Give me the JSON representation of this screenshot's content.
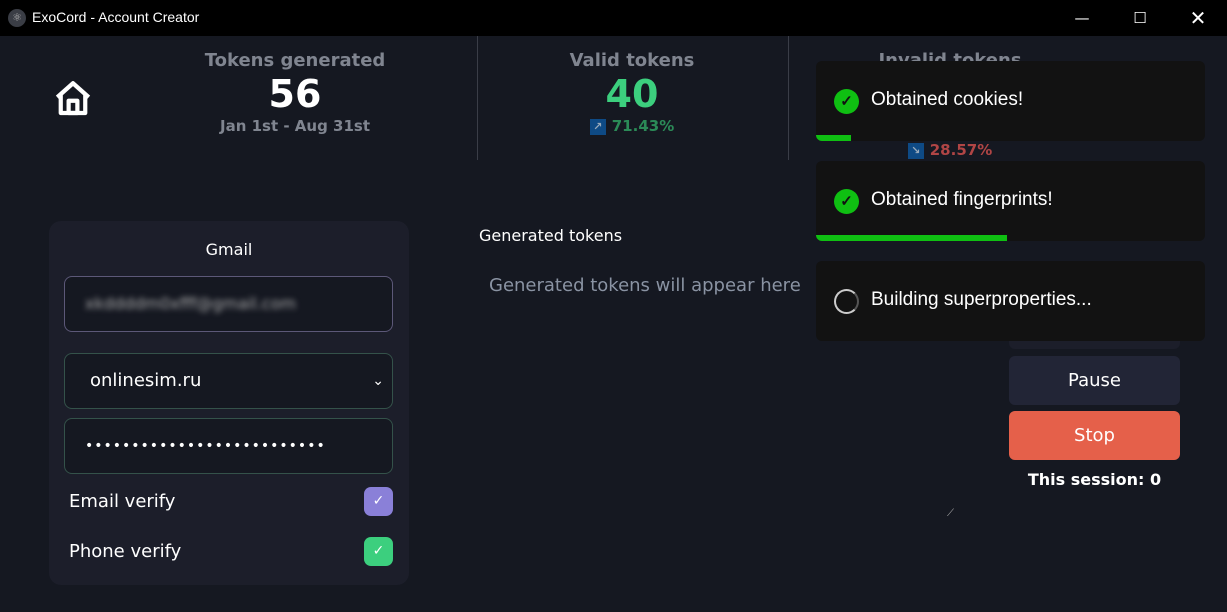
{
  "window": {
    "title": "ExoCord - Account Creator",
    "controls": [
      "minimize",
      "maximize",
      "close"
    ]
  },
  "stats": {
    "tokens_generated": {
      "label": "Tokens generated",
      "value": "56",
      "sub": "Jan 1st - Aug 31st"
    },
    "valid_tokens": {
      "label": "Valid tokens",
      "value": "40",
      "percent": "71.43%",
      "color": "#3ccf7e"
    },
    "invalid_tokens": {
      "label": "Invalid tokens",
      "percent": "28.57%",
      "color": "#d04a4a"
    }
  },
  "form": {
    "title": "Gmail",
    "email": "xkddddm0xfff@gmail.com",
    "sms_provider": "onlinesim.ru",
    "password": "••••••••••••••••••••••••••",
    "email_verify": {
      "label": "Email verify",
      "checked": true,
      "color": "#8a80d8"
    },
    "phone_verify": {
      "label": "Phone verify",
      "checked": true,
      "color": "#3ccf7e"
    }
  },
  "output": {
    "label": "Generated tokens",
    "placeholder": "Generated tokens will appear here"
  },
  "controls": {
    "pause": "Pause",
    "stop": "Stop",
    "session": "This session: 0"
  },
  "toasts": [
    {
      "text": "Obtained cookies!",
      "status": "success",
      "progress": 9
    },
    {
      "text": "Obtained fingerprints!",
      "status": "success",
      "progress": 49
    },
    {
      "text": "Building superproperties...",
      "status": "loading"
    }
  ]
}
